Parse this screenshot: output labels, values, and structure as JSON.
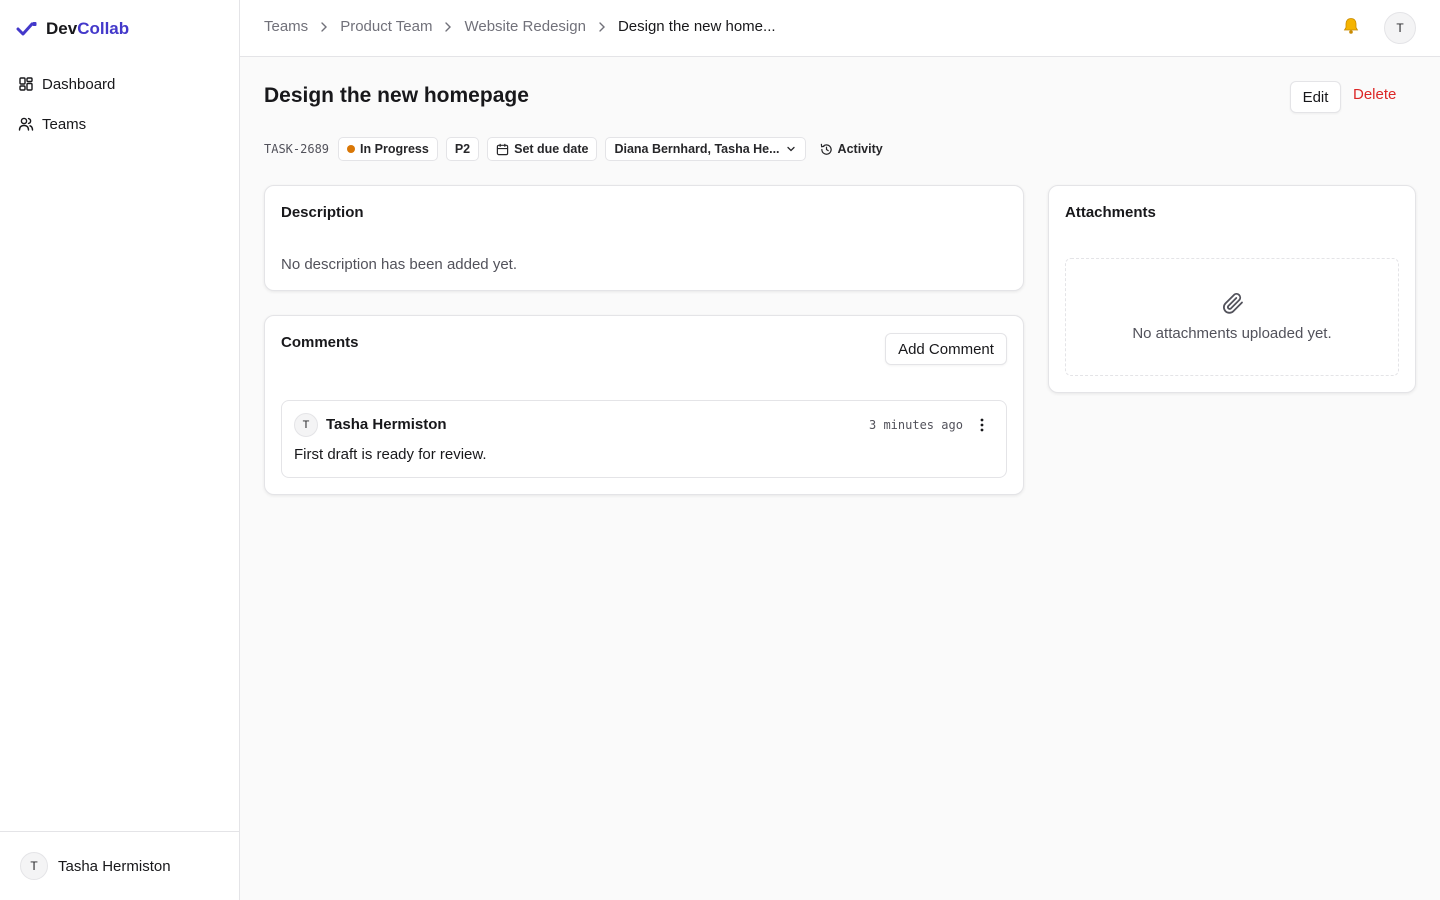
{
  "app": {
    "brand_part1": "Dev",
    "brand_part2": "Collab",
    "accent_color": "#4338ca"
  },
  "sidebar": {
    "items": [
      {
        "label": "Dashboard",
        "icon": "layout-grid-icon"
      },
      {
        "label": "Teams",
        "icon": "users-icon"
      }
    ],
    "user": {
      "initial": "T",
      "name": "Tasha Hermiston"
    }
  },
  "topbar": {
    "breadcrumb": [
      "Teams",
      "Product Team",
      "Website Redesign",
      "Design the new home..."
    ],
    "notification_icon": "bell-icon",
    "user_initial": "T"
  },
  "task": {
    "title": "Design the new homepage",
    "edit_label": "Edit",
    "delete_label": "Delete",
    "id": "TASK-2689",
    "status": "In Progress",
    "status_color": "#d97706",
    "priority": "P2",
    "due_date_label": "Set due date",
    "assignees": "Diana Bernhard, Tasha He...",
    "activity_label": "Activity"
  },
  "description": {
    "title": "Description",
    "text": "No description has been added yet."
  },
  "comments": {
    "title": "Comments",
    "add_label": "Add Comment",
    "items": [
      {
        "initial": "T",
        "author": "Tasha Hermiston",
        "time": "3 minutes ago",
        "body": "First draft is ready for review."
      }
    ]
  },
  "attachments": {
    "title": "Attachments",
    "empty_text": "No attachments uploaded yet."
  }
}
